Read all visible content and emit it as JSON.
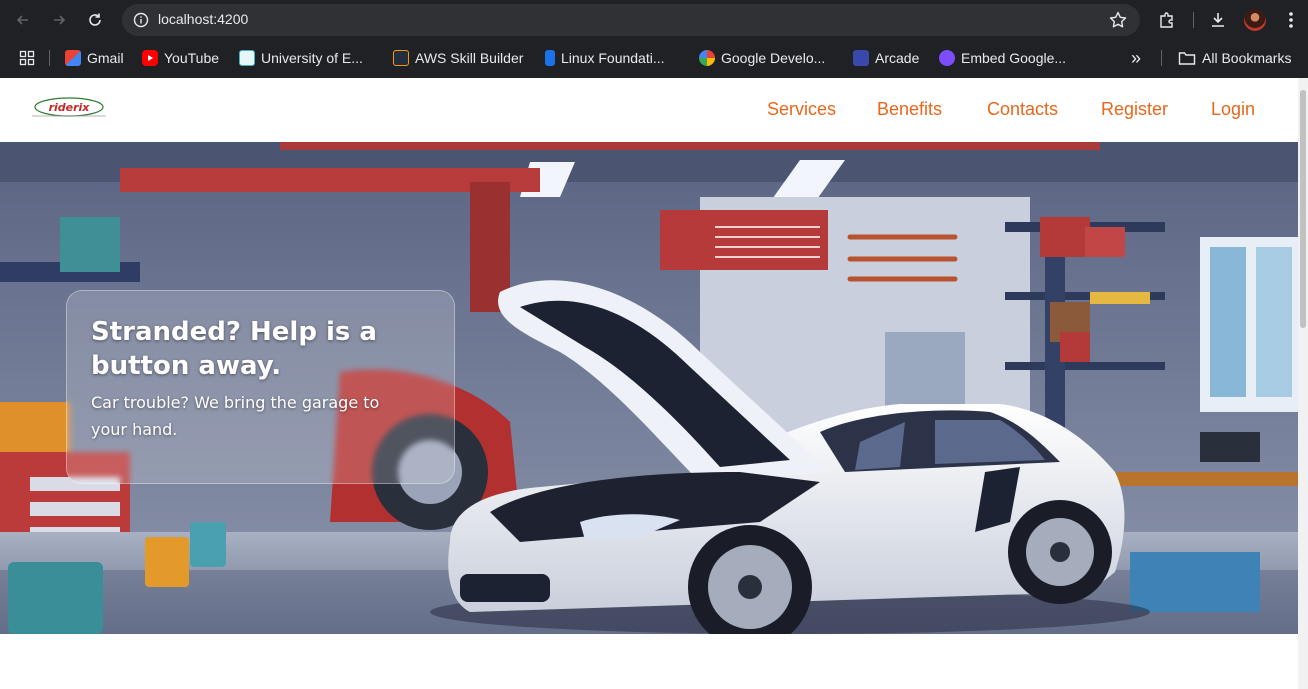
{
  "browser": {
    "url": "localhost:4200",
    "bookmarks": [
      {
        "label": "Gmail",
        "icon": "gmail-icon",
        "color": "#ea4335"
      },
      {
        "label": "YouTube",
        "icon": "youtube-icon",
        "color": "#ff0000"
      },
      {
        "label": "University of E...",
        "icon": "university-icon",
        "color": "#3fb3c8"
      },
      {
        "label": "AWS Skill Builder",
        "icon": "aws-icon",
        "color": "#232f3e"
      },
      {
        "label": "Linux Foundati...",
        "icon": "linux-foundation-icon",
        "color": "#1a73e8"
      },
      {
        "label": "Google Develo...",
        "icon": "google-icon",
        "color": "#4285f4"
      },
      {
        "label": "Arcade",
        "icon": "arcade-icon",
        "color": "#3949ab"
      },
      {
        "label": "Embed Google...",
        "icon": "embed-icon",
        "color": "#7c4dff"
      }
    ],
    "all_bookmarks_label": "All Bookmarks",
    "overflow_label": "»"
  },
  "site": {
    "brand_color": "#e8671c",
    "logo_text": "riderix",
    "nav": [
      {
        "label": "Services"
      },
      {
        "label": "Benefits"
      },
      {
        "label": "Contacts"
      },
      {
        "label": "Register"
      },
      {
        "label": "Login"
      }
    ]
  },
  "hero": {
    "title": "Stranded? Help is a button away.",
    "subtitle": "Car trouble? We bring the garage to your hand."
  }
}
